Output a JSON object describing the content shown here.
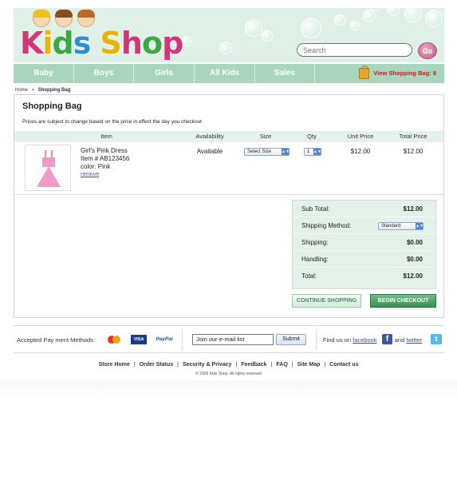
{
  "brand": {
    "logo_text": [
      "K",
      "i",
      "d",
      "s",
      " ",
      "S",
      "h",
      "o",
      "p"
    ]
  },
  "search": {
    "placeholder": "Search",
    "go_label": "Go"
  },
  "nav": {
    "items": [
      {
        "label": "Baby"
      },
      {
        "label": "Boys"
      },
      {
        "label": "Girls"
      },
      {
        "label": "All Kids"
      },
      {
        "label": "Sales"
      }
    ],
    "bag_label": "View Shopping Bag: 8"
  },
  "breadcrumb": {
    "home": "Home",
    "separator": "»",
    "current": "Shopping Bag"
  },
  "cart": {
    "title": "Shopping Bag",
    "notice": "Prices are subject to change based on the price in effect the day you checkout",
    "columns": [
      "Item",
      "Availability",
      "Size",
      "Qty",
      "Unit Price",
      "Total Price"
    ],
    "items": [
      {
        "name": "Girl's Pink Dress",
        "item_no": "Item # AB123456",
        "color": "color: Pink",
        "remove": "remove",
        "availability": "Available",
        "size_select": "Select Size",
        "qty": "1",
        "unit_price": "$12.00",
        "total_price": "$12.00"
      }
    ]
  },
  "totals": {
    "subtotal_label": "Sub Total:",
    "subtotal": "$12.00",
    "shipping_method_label": "Shipping Method:",
    "shipping_method": "Standard",
    "shipping_label": "Shipping:",
    "shipping": "$0.00",
    "handling_label": "Handling:",
    "handling": "$0.00",
    "total_label": "Total:",
    "total": "$12.00"
  },
  "buttons": {
    "continue": "CONTINUE SHOPPING",
    "checkout": "BEGIN CHECKOUT"
  },
  "footer": {
    "payment_label": "Accepted Pay ment Methods:",
    "payment_cards": [
      "MasterCard",
      "VISA",
      "PayPal"
    ],
    "email_placeholder": "Join our e-mail list",
    "submit": "Submit",
    "follow_prefix": "Find us on",
    "facebook": "facebook",
    "and": "and",
    "twitter": "twitter",
    "links": [
      "Store Home",
      "Order Status",
      "Security & Privacy",
      "Feedback",
      "FAQ",
      "Site Map",
      "Contact us"
    ],
    "link_separator": "|",
    "copyright": "© 2009 Kids Shop. All rights reserved"
  },
  "colors": {
    "header_bg": "#dff0e6",
    "nav_bg": "#a9d4bd",
    "bag_link": "#c81d1d",
    "checkout_btn": "#3e8d58",
    "logo": [
      "#d6347a",
      "#e8b400",
      "#3aa843",
      "#2e8fd6",
      "#ffffff",
      "#e8b400",
      "#d6347a",
      "#3aa843",
      "#d6347a"
    ]
  }
}
